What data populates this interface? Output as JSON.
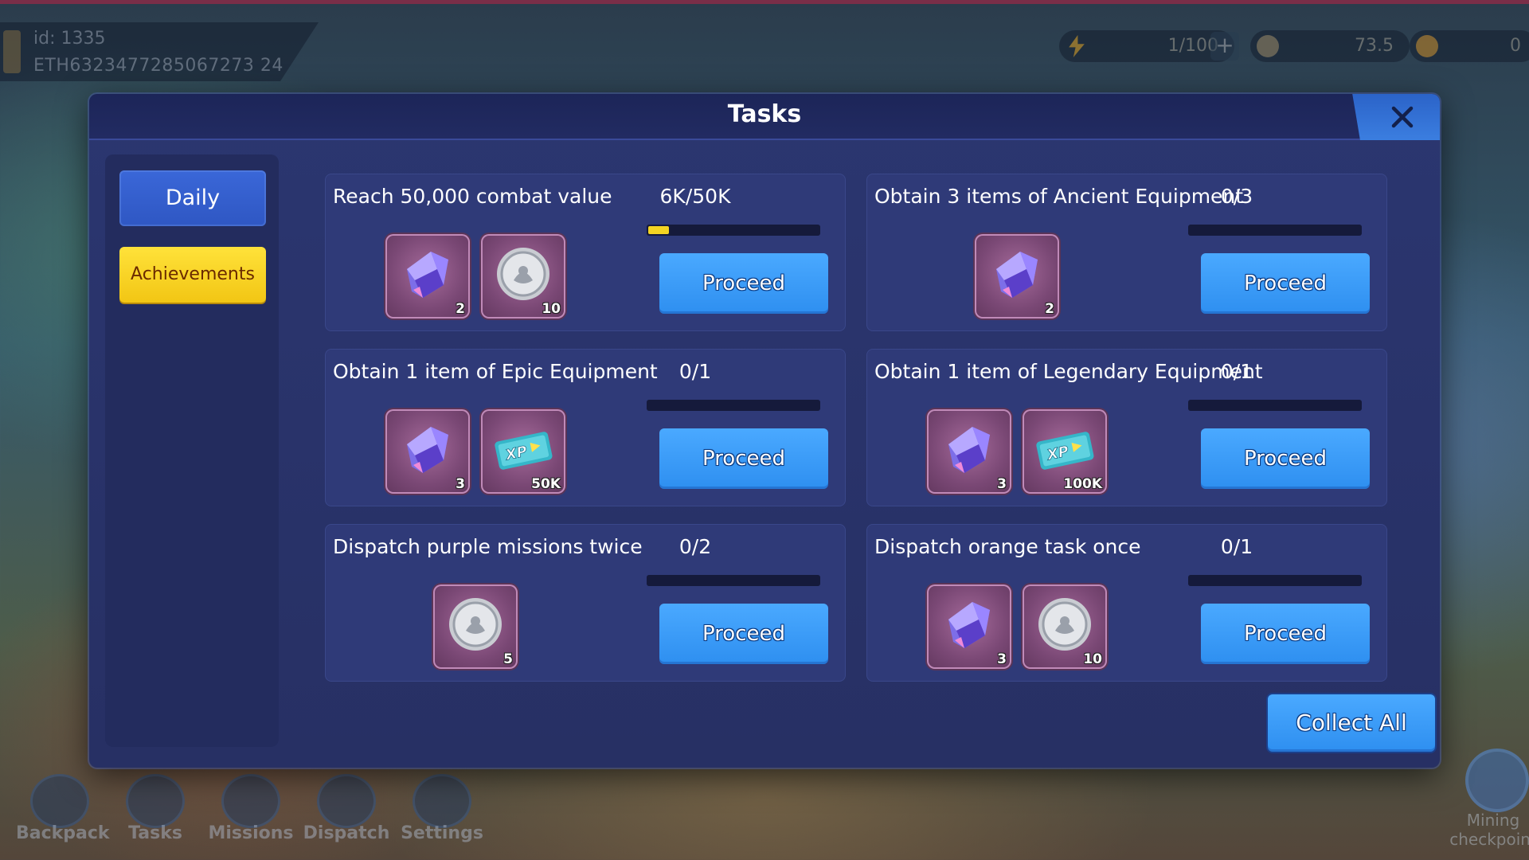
{
  "hud": {
    "id_text": "id: 1335",
    "address": "ETH6323477285067273 24",
    "energy": "1/100",
    "coins": "73.5",
    "gold": "0"
  },
  "bottom_nav": [
    "Backpack",
    "Tasks",
    "Missions",
    "Dispatch",
    "Settings"
  ],
  "mining_label": "Mining checkpoint",
  "modal": {
    "title": "Tasks",
    "tabs": {
      "daily": "Daily",
      "achievements": "Achievements"
    },
    "collect_all": "Collect All"
  },
  "tasks": [
    {
      "title": "Reach 50,000 combat value",
      "count": "6K/50K",
      "progress": 0.12,
      "button": "Proceed",
      "rewards": [
        {
          "icon": "crystal-icon",
          "qty": "2"
        },
        {
          "icon": "silver-coin-icon",
          "qty": "10"
        }
      ]
    },
    {
      "title": "Obtain 3 items of Ancient Equipment",
      "count": "0/3",
      "progress": 0,
      "button": "Proceed",
      "rewards": [
        {
          "icon": "crystal-icon",
          "qty": "2"
        }
      ]
    },
    {
      "title": "Obtain 1 item of Epic Equipment",
      "count": "0/1",
      "progress": 0,
      "button": "Proceed",
      "rewards": [
        {
          "icon": "crystal-icon",
          "qty": "3"
        },
        {
          "icon": "xp-ticket-icon",
          "qty": "50K"
        }
      ]
    },
    {
      "title": "Obtain 1 item of Legendary Equipment",
      "count": "0/1",
      "progress": 0,
      "button": "Proceed",
      "rewards": [
        {
          "icon": "crystal-icon",
          "qty": "3"
        },
        {
          "icon": "xp-ticket-icon",
          "qty": "100K"
        }
      ]
    },
    {
      "title": "Dispatch purple missions twice",
      "count": "0/2",
      "progress": 0,
      "button": "Proceed",
      "rewards": [
        {
          "icon": "silver-coin-icon",
          "qty": "5"
        }
      ]
    },
    {
      "title": "Dispatch orange task once",
      "count": "0/1",
      "progress": 0,
      "button": "Proceed",
      "rewards": [
        {
          "icon": "crystal-icon",
          "qty": "3"
        },
        {
          "icon": "silver-coin-icon",
          "qty": "10"
        }
      ]
    }
  ],
  "colors": {
    "modal_bg": "#2b3670",
    "card_bg": "#2f3a78",
    "button_blue": "#3b9bf8",
    "tab_active": "#3461cf",
    "tab_yellow": "#f7d42a",
    "progress_fill": "#f4d422",
    "reward_bg": "#7a4875"
  }
}
